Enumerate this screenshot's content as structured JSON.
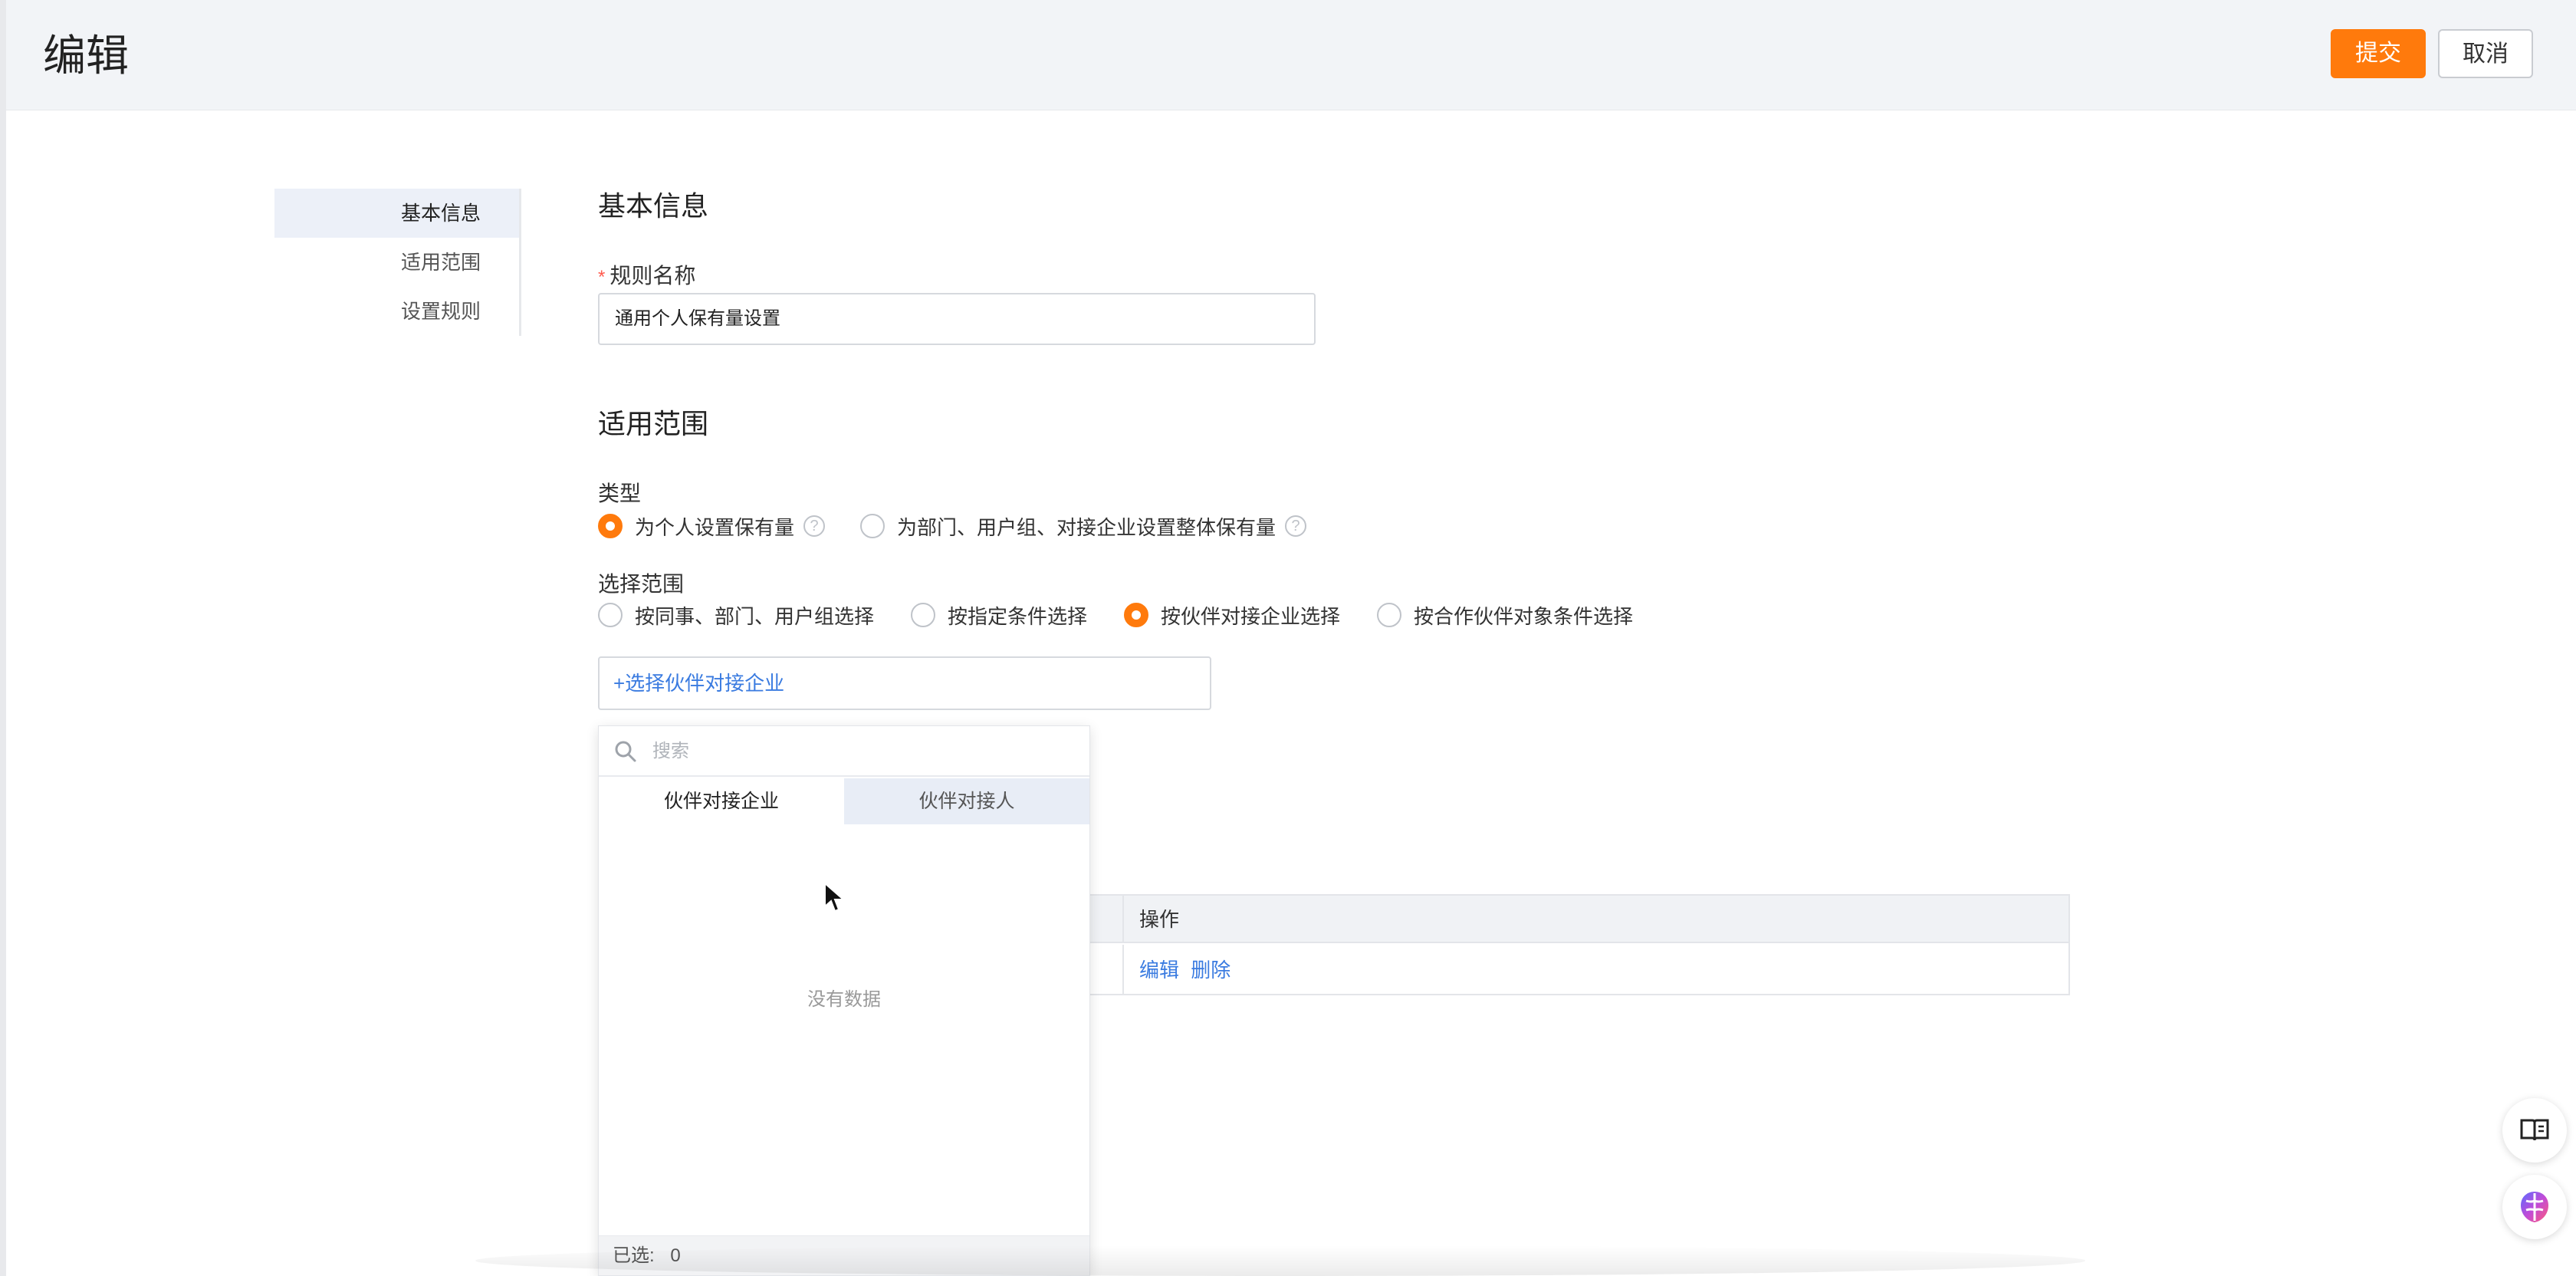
{
  "header": {
    "title": "编辑",
    "submit_label": "提交",
    "cancel_label": "取消"
  },
  "side_nav": {
    "items": [
      {
        "label": "基本信息",
        "active": true
      },
      {
        "label": "适用范围",
        "active": false
      },
      {
        "label": "设置规则",
        "active": false
      }
    ]
  },
  "basic_info": {
    "section_title": "基本信息",
    "required_mark": "*",
    "rule_name_label": "规则名称",
    "rule_name_value": "通用个人保有量设置"
  },
  "scope": {
    "section_title": "适用范围",
    "type_label": "类型",
    "type_options": [
      {
        "label": "为个人设置保有量",
        "selected": true
      },
      {
        "label": "为部门、用户组、对接企业设置整体保有量",
        "selected": false
      }
    ],
    "range_label": "选择范围",
    "range_options": [
      {
        "label": "按同事、部门、用户组选择",
        "selected": false
      },
      {
        "label": "按指定条件选择",
        "selected": false
      },
      {
        "label": "按伙伴对接企业选择",
        "selected": true
      },
      {
        "label": "按合作伙伴对象条件选择",
        "selected": false
      }
    ],
    "pick_label": "+选择伙伴对接企业"
  },
  "dropdown": {
    "search_placeholder": "搜索",
    "tabs": [
      {
        "label": "伙伴对接企业",
        "active": true
      },
      {
        "label": "伙伴对接人",
        "active": false
      }
    ],
    "empty_text": "没有数据",
    "selected_label": "已选:",
    "selected_count": "0"
  },
  "table": {
    "header_action": "操作",
    "row_edit": "编辑",
    "row_delete": "删除"
  },
  "icons": {
    "help": "question-circle-icon",
    "search": "search-icon",
    "book": "book-icon",
    "ai": "ai-brain-icon"
  },
  "colors": {
    "accent": "#ff7a0c",
    "link": "#3a7be0"
  }
}
